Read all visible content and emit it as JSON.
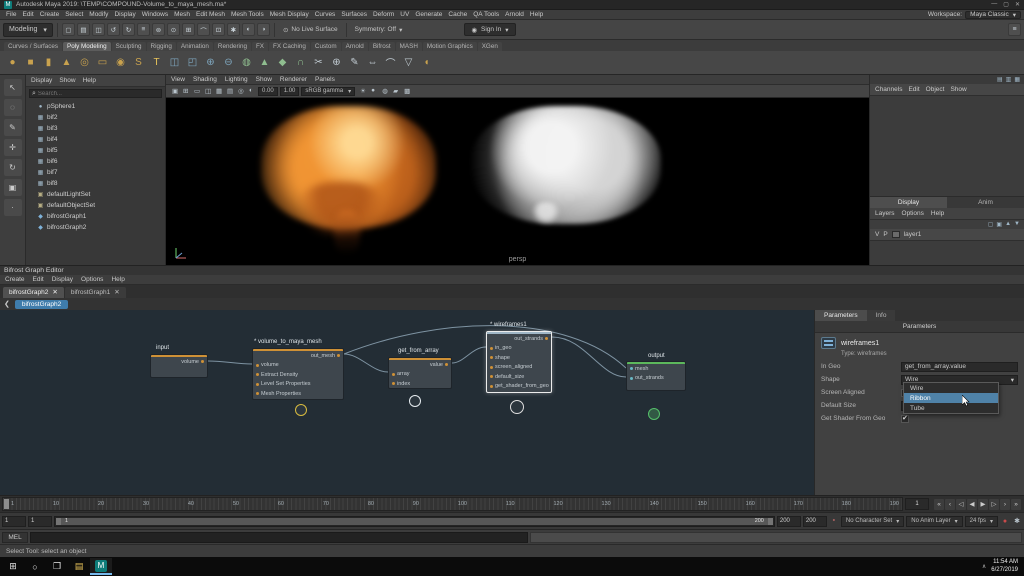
{
  "colors": {
    "selection_blue": "#4f82a8",
    "node_orange": "#cf9136",
    "node_green": "#5cb85c",
    "watch_yellow": "#d8bb3f",
    "maya_teal": "#0e7c7a",
    "breadcrumb_blue": "#3f7cab"
  },
  "icons": {
    "minimize": "—",
    "maximize": "▢",
    "close": "✕",
    "dropdown": "▾",
    "back": "❮",
    "search": "⌕",
    "user": "◉",
    "magnet": "⊙",
    "panel_menu": "≡",
    "tab_close": "✕",
    "tray_up": "∧",
    "start": "⊞",
    "search_circle": "○",
    "task_view": "❒",
    "folder": "▤"
  },
  "titlebar": {
    "title": "Autodesk Maya 2019: \\TEMP\\COMPOUND-Volume_to_maya_mesh.ma*",
    "badge": "M"
  },
  "menubar": {
    "items": [
      "File",
      "Edit",
      "Create",
      "Select",
      "Modify",
      "Display",
      "Windows",
      "Mesh",
      "Edit Mesh",
      "Mesh Tools",
      "Mesh Display",
      "Curves",
      "Surfaces",
      "Deform",
      "UV",
      "Generate",
      "Cache",
      "QA Tools",
      "Arnold",
      "Help"
    ]
  },
  "workspace": {
    "label": "Workspace:",
    "value": "Maya Classic"
  },
  "toolbar": {
    "mode": "Modeling",
    "no_live_surface": "No Live Surface",
    "symmetry": "Symmetry: Off",
    "sign_in": "Sign In",
    "icons": [
      {
        "name": "new-scene-icon",
        "glyph": "▢"
      },
      {
        "name": "open-scene-icon",
        "glyph": "▤"
      },
      {
        "name": "save-scene-icon",
        "glyph": "◫"
      },
      {
        "name": "undo-icon",
        "glyph": "↺"
      },
      {
        "name": "redo-icon",
        "glyph": "↻"
      },
      {
        "name": "select-hierarchy-icon",
        "glyph": "≡"
      },
      {
        "name": "select-object-icon",
        "glyph": "⊚"
      },
      {
        "name": "select-component-icon",
        "glyph": "⊙"
      },
      {
        "name": "snap-grid-icon",
        "glyph": "⊞"
      },
      {
        "name": "snap-curve-icon",
        "glyph": "⌒"
      },
      {
        "name": "snap-point-icon",
        "glyph": "⊡"
      },
      {
        "name": "construction-history-icon",
        "glyph": "✱"
      },
      {
        "name": "render-icon",
        "glyph": "◐"
      },
      {
        "name": "ipr-render-icon",
        "glyph": "◑"
      }
    ]
  },
  "shelf": {
    "active": "Poly Modeling",
    "tabs": [
      "Curves / Surfaces",
      "Poly Modeling",
      "Sculpting",
      "Rigging",
      "Animation",
      "Rendering",
      "FX",
      "FX Caching",
      "Custom",
      "Arnold",
      "Bifrost",
      "MASH",
      "Motion Graphics",
      "XGen"
    ],
    "icons": [
      {
        "name": "poly-sphere-icon",
        "glyph": "●",
        "color": "#c9a24e"
      },
      {
        "name": "poly-cube-icon",
        "glyph": "■",
        "color": "#c9a24e"
      },
      {
        "name": "poly-cylinder-icon",
        "glyph": "▮",
        "color": "#c9a24e"
      },
      {
        "name": "poly-cone-icon",
        "glyph": "▲",
        "color": "#c9a24e"
      },
      {
        "name": "poly-torus-icon",
        "glyph": "◎",
        "color": "#c9a24e"
      },
      {
        "name": "poly-plane-icon",
        "glyph": "▭",
        "color": "#c9a24e"
      },
      {
        "name": "poly-disc-icon",
        "glyph": "◉",
        "color": "#c9a24e"
      },
      {
        "name": "poly-helix-icon",
        "glyph": "S",
        "color": "#c9a24e"
      },
      {
        "name": "poly-text-icon",
        "glyph": "T",
        "color": "#e8c35a"
      },
      {
        "name": "boolean-union-icon",
        "glyph": "◫",
        "color": "#7fa7bf"
      },
      {
        "name": "boolean-difference-icon",
        "glyph": "◰",
        "color": "#7fa7bf"
      },
      {
        "name": "combine-icon",
        "glyph": "⊕",
        "color": "#7fa7bf"
      },
      {
        "name": "separate-icon",
        "glyph": "⊖",
        "color": "#7fa7bf"
      },
      {
        "name": "smooth-icon",
        "glyph": "◍",
        "color": "#8fbd8f"
      },
      {
        "name": "extrude-icon",
        "glyph": "▲",
        "color": "#8fbd8f"
      },
      {
        "name": "bevel-icon",
        "glyph": "◆",
        "color": "#8fbd8f"
      },
      {
        "name": "bridge-icon",
        "glyph": "∩",
        "color": "#8fbd8f"
      },
      {
        "name": "multi-cut-icon",
        "glyph": "✂",
        "color": "#c2ccd3"
      },
      {
        "name": "target-weld-icon",
        "glyph": "⊕",
        "color": "#c2ccd3"
      },
      {
        "name": "quad-draw-icon",
        "glyph": "✎",
        "color": "#c2ccd3"
      },
      {
        "name": "mirror-icon",
        "glyph": "⇔",
        "color": "#c2ccd3"
      },
      {
        "name": "crease-icon",
        "glyph": "⌒",
        "color": "#c2ccd3"
      },
      {
        "name": "reduce-icon",
        "glyph": "▽",
        "color": "#c2ccd3"
      },
      {
        "name": "sculpt-icon",
        "glyph": "◖",
        "color": "#c9a24e"
      }
    ]
  },
  "toolbox": {
    "tools": [
      {
        "name": "select-tool",
        "glyph": "↖"
      },
      {
        "name": "lasso-tool",
        "glyph": "◌"
      },
      {
        "name": "paint-select-tool",
        "glyph": "✎"
      },
      {
        "name": "move-tool",
        "glyph": "✛"
      },
      {
        "name": "rotate-tool",
        "glyph": "↻"
      },
      {
        "name": "scale-tool",
        "glyph": "▣"
      },
      {
        "name": "last-tool",
        "glyph": "·"
      }
    ]
  },
  "outliner": {
    "menus": [
      "Display",
      "Show",
      "Help"
    ],
    "search_placeholder": "Search...",
    "items": [
      {
        "label": "pSphere1",
        "icon_glyph": "●",
        "icon_color": "#9fb6c6"
      },
      {
        "label": "bif2",
        "icon_glyph": "▦",
        "icon_color": "#9fb6c6"
      },
      {
        "label": "bif3",
        "icon_glyph": "▦",
        "icon_color": "#9fb6c6"
      },
      {
        "label": "bif4",
        "icon_glyph": "▦",
        "icon_color": "#9fb6c6"
      },
      {
        "label": "bif5",
        "icon_glyph": "▦",
        "icon_color": "#9fb6c6"
      },
      {
        "label": "bif6",
        "icon_glyph": "▦",
        "icon_color": "#9fb6c6"
      },
      {
        "label": "bif7",
        "icon_glyph": "▦",
        "icon_color": "#9fb6c6"
      },
      {
        "label": "bif8",
        "icon_glyph": "▦",
        "icon_color": "#9fb6c6"
      },
      {
        "label": "defaultLightSet",
        "icon_glyph": "▣",
        "icon_color": "#b7ae84"
      },
      {
        "label": "defaultObjectSet",
        "icon_glyph": "▣",
        "icon_color": "#b7ae84"
      },
      {
        "label": "bifrostGraph1",
        "icon_glyph": "◆",
        "icon_color": "#7fb2d9"
      },
      {
        "label": "bifrostGraph2",
        "icon_glyph": "◆",
        "icon_color": "#7fb2d9"
      }
    ]
  },
  "viewport": {
    "menus": [
      "View",
      "Shading",
      "Lighting",
      "Show",
      "Renderer",
      "Panels"
    ],
    "toolbar_icons": [
      {
        "name": "camera-attrs-icon",
        "glyph": "▣"
      },
      {
        "name": "grid-icon",
        "glyph": "⊞"
      },
      {
        "name": "film-gate-icon",
        "glyph": "▭"
      },
      {
        "name": "resolution-gate-icon",
        "glyph": "◫"
      },
      {
        "name": "gate-mask-icon",
        "glyph": "▦"
      },
      {
        "name": "safe-action-icon",
        "glyph": "▤"
      },
      {
        "name": "isolate-select-icon",
        "glyph": "◎"
      },
      {
        "name": "xray-icon",
        "glyph": "◐"
      }
    ],
    "exposure": "0.00",
    "gamma": "1.00",
    "view_transform": "sRGB gamma",
    "toolbar_icons2": [
      {
        "name": "lighting-icon",
        "glyph": "☀"
      },
      {
        "name": "shadows-icon",
        "glyph": "●"
      },
      {
        "name": "ambient-occlusion-icon",
        "glyph": "◍"
      },
      {
        "name": "anti-alias-icon",
        "glyph": "▰"
      },
      {
        "name": "textures-icon",
        "glyph": "▩"
      }
    ],
    "camera_label": "persp"
  },
  "channelbox": {
    "header_icons": [
      {
        "name": "channelbox-display-icon",
        "glyph": "▤"
      },
      {
        "name": "channelbox-speed-icon",
        "glyph": "▥"
      },
      {
        "name": "channelbox-manip-icon",
        "glyph": "▦"
      }
    ],
    "menus": [
      "Channels",
      "Edit",
      "Object",
      "Show"
    ],
    "layer_tabs": [
      "Display",
      "Anim"
    ],
    "layer_menus": [
      "Layers",
      "Options",
      "Help"
    ],
    "layer_toolbar_icons": [
      {
        "name": "new-empty-layer-icon",
        "glyph": "▢"
      },
      {
        "name": "new-layer-selected-icon",
        "glyph": "▣"
      },
      {
        "name": "move-layer-up-icon",
        "glyph": "▲"
      },
      {
        "name": "move-layer-down-icon",
        "glyph": "▼"
      }
    ],
    "layer": {
      "v": "V",
      "p": "P",
      "name": "layer1"
    }
  },
  "graph_editor": {
    "title": "Bifrost Graph Editor",
    "menus": [
      "Create",
      "Edit",
      "Display",
      "Options",
      "Help"
    ],
    "tabs": [
      {
        "label": "bifrostGraph2"
      },
      {
        "label": "bifrostGraph1"
      }
    ],
    "breadcrumb": "bifrostGraph2",
    "nodes": {
      "input": {
        "title": "input",
        "ports_out": [
          "volume"
        ]
      },
      "v2m": {
        "title": "* volume_to_maya_mesh",
        "ports_out": [
          "out_mesh"
        ],
        "ports_in": [
          "volume",
          "Extract Density",
          "Level Set Properties",
          "Mesh Properties"
        ]
      },
      "gfa": {
        "title": "get_from_array",
        "ports_out": [
          "value"
        ],
        "ports_in": [
          "array",
          "index"
        ]
      },
      "wire": {
        "title": "* wireframes1",
        "ports_out": [
          "out_strands"
        ],
        "ports_in": [
          "in_geo",
          "shape",
          "screen_aligned",
          "default_size",
          "get_shader_from_geo"
        ]
      },
      "output": {
        "title": "output",
        "ports_in": [
          "mesh",
          "out_strands"
        ]
      }
    },
    "params": {
      "tabs": [
        "Parameters",
        "Info"
      ],
      "header": "Parameters",
      "node_name": "wireframes1",
      "node_type": "Type: wireframes",
      "in_geo_label": "In Geo",
      "in_geo_value": "get_from_array.value",
      "shape_label": "Shape",
      "shape_value": "Wire",
      "screen_aligned_label": "Screen Aligned",
      "default_size_label": "Default Size",
      "default_size_value": "",
      "get_shader_label": "Get Shader From Geo",
      "get_shader_check": "✔",
      "shape_options": [
        "Wire",
        "Ribbon",
        "Tube"
      ],
      "highlighted_option": "Ribbon"
    }
  },
  "timeline": {
    "ticks": [
      "1",
      "10",
      "20",
      "30",
      "40",
      "50",
      "60",
      "70",
      "80",
      "90",
      "100",
      "110",
      "120",
      "130",
      "140",
      "150",
      "160",
      "170",
      "180",
      "190"
    ],
    "current": "1",
    "transport": [
      {
        "name": "go-to-start-button",
        "glyph": "«"
      },
      {
        "name": "step-back-key-button",
        "glyph": "‹"
      },
      {
        "name": "step-back-frame-button",
        "glyph": "◁"
      },
      {
        "name": "play-backwards-button",
        "glyph": "◀"
      },
      {
        "name": "play-forwards-button",
        "glyph": "▶"
      },
      {
        "name": "step-forward-frame-button",
        "glyph": "▷"
      },
      {
        "name": "step-forward-key-button",
        "glyph": "›"
      },
      {
        "name": "go-to-end-button",
        "glyph": "»"
      }
    ]
  },
  "range": {
    "playback_start": "1",
    "anim_start": "1",
    "slider_min": "1",
    "slider_max": "200",
    "anim_end": "200",
    "playback_end": "200",
    "character_set": "No Character Set",
    "anim_layer": "No Anim Layer",
    "fps": "24 fps"
  },
  "command_line": {
    "label": "MEL"
  },
  "help_line": {
    "text": "Select Tool: select an object"
  },
  "taskbar": {
    "maya_letter": "M",
    "time": "11:54 AM",
    "date": "6/27/2019"
  }
}
